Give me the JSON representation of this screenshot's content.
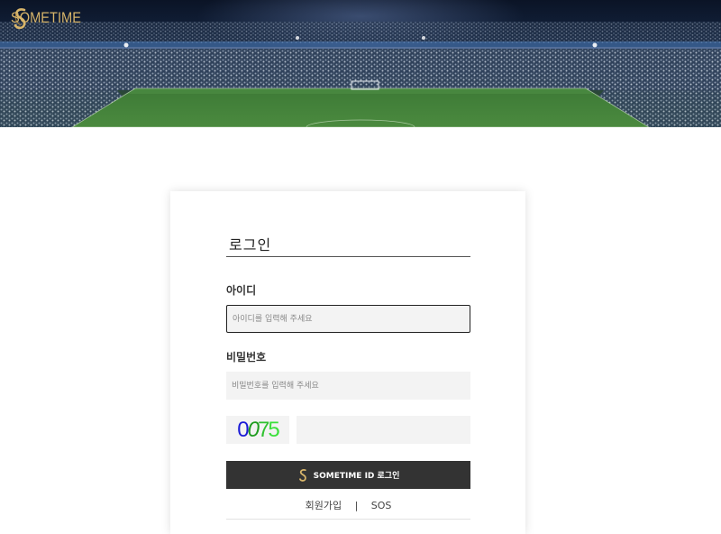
{
  "brand": {
    "name": "SOMETIME",
    "gold_color": "#d8b56a"
  },
  "login": {
    "title": "로그인",
    "id_label": "아이디",
    "id_placeholder": "아이디를 입력해 주세요",
    "password_label": "비밀번호",
    "password_placeholder": "비밀번호를 입력해 주세요",
    "captcha_digits": [
      {
        "char": "0",
        "color": "#1b1bd6"
      },
      {
        "char": "0",
        "color": "#1f9c1f"
      },
      {
        "char": "7",
        "color": "#30c230"
      },
      {
        "char": "5",
        "color": "#3be03b"
      }
    ],
    "captcha_input_placeholder": "",
    "submit_label": "SOMETIME ID 로그인",
    "button_color": "#333333"
  },
  "links": {
    "signup": "회원가입",
    "separator": "|",
    "sos": "SOS"
  }
}
